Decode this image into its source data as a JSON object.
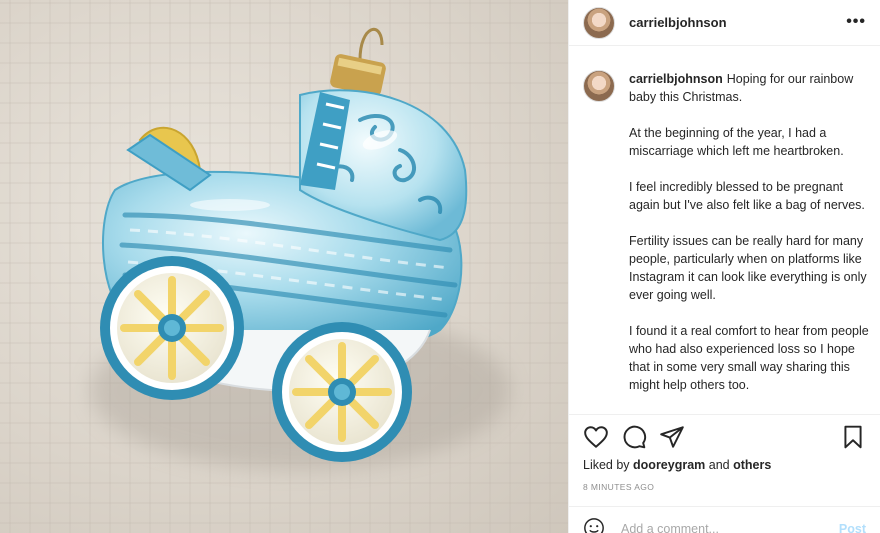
{
  "post": {
    "username": "carrielbjohnson",
    "more_label": "•••",
    "caption_user": "carrielbjohnson",
    "caption_paragraphs": [
      "Hoping for our rainbow baby this Christmas.",
      "At the beginning of the year, I had a miscarriage which left me heartbroken.",
      "I feel incredibly blessed to be pregnant again but I've also felt like a bag of nerves.",
      "Fertility issues can be really hard for many people, particularly when on platforms like Instagram it can look like everything is only ever going well.",
      "I found it a real comfort to hear from people who had also experienced loss so I hope that in some very small way sharing this might help others too."
    ],
    "likes_prefix": "Liked by ",
    "likes_user": "dooreygram",
    "likes_and": " and ",
    "likes_others": "others",
    "timestamp": "8 MINUTES AGO",
    "comment_placeholder": "Add a comment...",
    "post_label": "Post"
  },
  "icons": {
    "like": "heart-icon",
    "comment": "comment-icon",
    "share": "share-icon",
    "save": "bookmark-icon",
    "emoji": "smiley-icon"
  },
  "colors": {
    "text": "#262626",
    "muted": "#8e8e8e",
    "post_disabled": "#b2dffc",
    "ornament_blue": "#5fb8d6",
    "ornament_yellow": "#f2d46a"
  }
}
